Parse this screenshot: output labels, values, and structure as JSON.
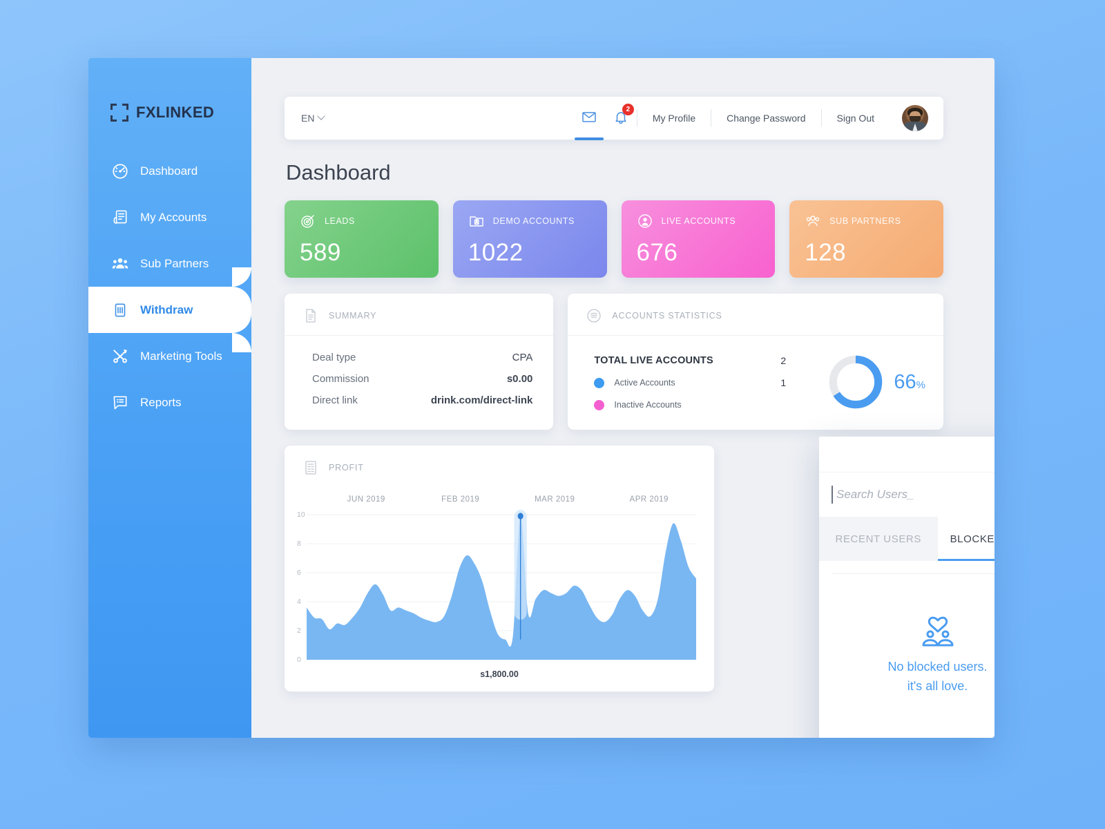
{
  "brand": {
    "name": "FXLINKED"
  },
  "sidebar": {
    "items": [
      {
        "label": "Dashboard",
        "icon": "speedometer-icon",
        "active": false
      },
      {
        "label": "My Accounts",
        "icon": "accounts-icon",
        "active": false
      },
      {
        "label": "Sub Partners",
        "icon": "group-icon",
        "active": false
      },
      {
        "label": "Withdraw",
        "icon": "withdraw-icon",
        "active": true
      },
      {
        "label": "Marketing Tools",
        "icon": "tools-icon",
        "active": false
      },
      {
        "label": "Reports",
        "icon": "reports-icon",
        "active": false
      }
    ]
  },
  "topbar": {
    "language": "EN",
    "mail_icon": "mail-icon",
    "bell_icon": "bell-icon",
    "notification_count": "2",
    "links": [
      "My Profile",
      "Change Password",
      "Sign Out"
    ]
  },
  "page": {
    "title": "Dashboard"
  },
  "stats": [
    {
      "label": "LEADS",
      "value": "589",
      "icon": "target-icon",
      "theme": "green"
    },
    {
      "label": "DEMO ACCOUNTS",
      "value": "1022",
      "icon": "idcard-icon",
      "theme": "purple"
    },
    {
      "label": "LIVE ACCOUNTS",
      "value": "676",
      "icon": "person-icon",
      "theme": "pink"
    },
    {
      "label": "SUB PARTNERS",
      "value": "128",
      "icon": "partners-icon",
      "theme": "orange"
    }
  ],
  "summary": {
    "title": "SUMMARY",
    "icon": "document-icon",
    "rows": [
      {
        "key": "Deal type",
        "value": "CPA"
      },
      {
        "key": "Commission",
        "value": "s0.00"
      },
      {
        "key": "Direct link",
        "value": "drink.com/direct-link"
      }
    ]
  },
  "accounts_statistics": {
    "title": "ACCOUNTS STATISTICS",
    "icon": "stats-icon",
    "total_label": "TOTAL LIVE ACCOUNTS",
    "total_value": "2",
    "legend": [
      {
        "label": "Active Accounts",
        "value": "1",
        "color": "#3d9bf0"
      },
      {
        "label": "Inactive Accounts",
        "value": "",
        "color": "#f45fd0"
      }
    ],
    "gauge_percent": 66,
    "gauge_value": "66",
    "gauge_unit": "%",
    "gauge_color": "#4a9cf0",
    "gauge_track": "#e6e8ec"
  },
  "profit": {
    "title": "PROFIT",
    "icon": "report-icon",
    "value_label": "s1,800.00"
  },
  "chart_data": {
    "type": "area",
    "title": "PROFIT",
    "xlabel": "",
    "ylabel": "",
    "ylim": [
      0,
      10
    ],
    "yticks": [
      0,
      2,
      4,
      6,
      8,
      10
    ],
    "grid": true,
    "legend": "none",
    "tick_labels": [
      "JUN 2019",
      "FEB 2019",
      "MAR 2019",
      "APR 2019"
    ],
    "color": "#79b7f2",
    "annotation": {
      "label": "s1,800.00",
      "x_index": 28,
      "y": 9.9
    },
    "values": [
      3.6,
      2.9,
      2.8,
      2.1,
      2.5,
      2.4,
      2.9,
      3.6,
      4.6,
      5.2,
      4.5,
      3.4,
      3.6,
      3.4,
      3.2,
      2.9,
      2.7,
      2.6,
      3.0,
      4.4,
      6.3,
      7.2,
      6.6,
      5.4,
      3.4,
      1.8,
      1.4,
      1.6,
      9.9,
      3.2,
      4.2,
      4.8,
      4.6,
      4.4,
      4.6,
      5.1,
      4.8,
      3.8,
      2.9,
      2.6,
      3.1,
      4.2,
      4.8,
      4.4,
      3.4,
      3.0,
      4.2,
      7.4,
      9.4,
      8.2,
      6.4,
      5.6
    ]
  },
  "users_panel": {
    "close_icon": "close-icon",
    "search_icon": "search-icon",
    "search_value": "",
    "search_placeholder": "Search Users_",
    "tabs": [
      {
        "label": "RECENT USERS",
        "active": false
      },
      {
        "label": "BLOCKED USERS",
        "active": true
      }
    ],
    "empty_icon": "blocked-users-empty-icon",
    "empty_line1": "No blocked users.",
    "empty_line2": "it's all love."
  }
}
